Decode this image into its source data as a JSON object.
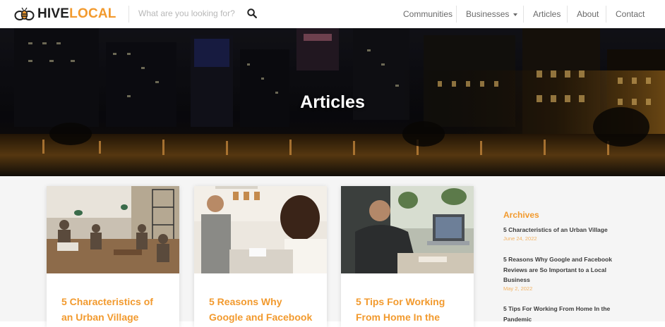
{
  "header": {
    "logo_hive": "HIVE",
    "logo_local": "LOCAL",
    "search_placeholder": "What are you looking for?",
    "nav": [
      {
        "label": "Communities"
      },
      {
        "label": "Businesses"
      },
      {
        "label": "Articles"
      },
      {
        "label": "About"
      },
      {
        "label": "Contact"
      }
    ]
  },
  "hero": {
    "title": "Articles"
  },
  "cards": [
    {
      "title": "5 Characteristics of an Urban Village"
    },
    {
      "title": "5 Reasons Why Google and Facebook"
    },
    {
      "title": "5 Tips For Working From Home In the"
    }
  ],
  "sidebar": {
    "title": "Archives",
    "items": [
      {
        "title": "5 Characteristics of an Urban Village",
        "date": "June 24, 2022"
      },
      {
        "title": "5 Reasons Why Google and Facebook Reviews are So Important to a Local Business",
        "date": "May 2, 2022"
      },
      {
        "title": "5 Tips For Working From Home In the Pandemic",
        "date": ""
      }
    ]
  },
  "colors": {
    "accent": "#f29a2e",
    "text_dark": "#3c3c3c",
    "nav_text": "#6a6a6a"
  }
}
